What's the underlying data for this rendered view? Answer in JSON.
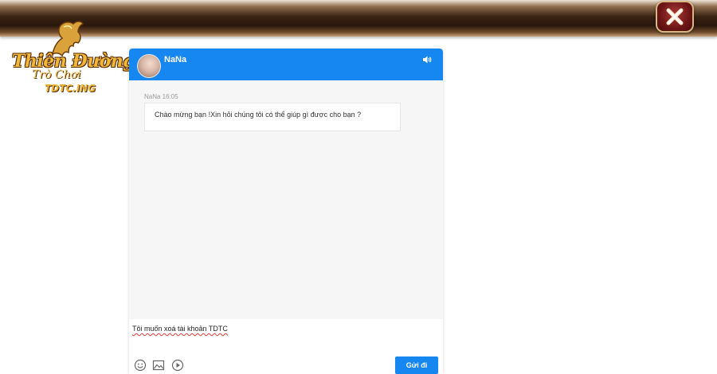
{
  "logo": {
    "title": "Thiên Đường",
    "subtitle": "Trò Chơi",
    "domain": "TDTC.ING"
  },
  "top_bar": {
    "close_icon": "close-icon"
  },
  "chat": {
    "header": {
      "agent_name": "NaNa",
      "avatar_icon": "avatar",
      "sound_icon": "speaker-icon",
      "color": "#1687f0"
    },
    "messages": [
      {
        "sender": "NaNa",
        "time": "16:05",
        "meta": "NaNa 16:05",
        "text": "Chào mừng bạn !Xin hỏi chúng tôi có thể giúp gì được cho bạn ?"
      }
    ],
    "composer": {
      "value": "Tôi muốn xoá tài khoản TDTC",
      "tools": [
        "emoji-icon",
        "image-icon",
        "video-icon"
      ],
      "send_label": "Gửi đi"
    }
  }
}
